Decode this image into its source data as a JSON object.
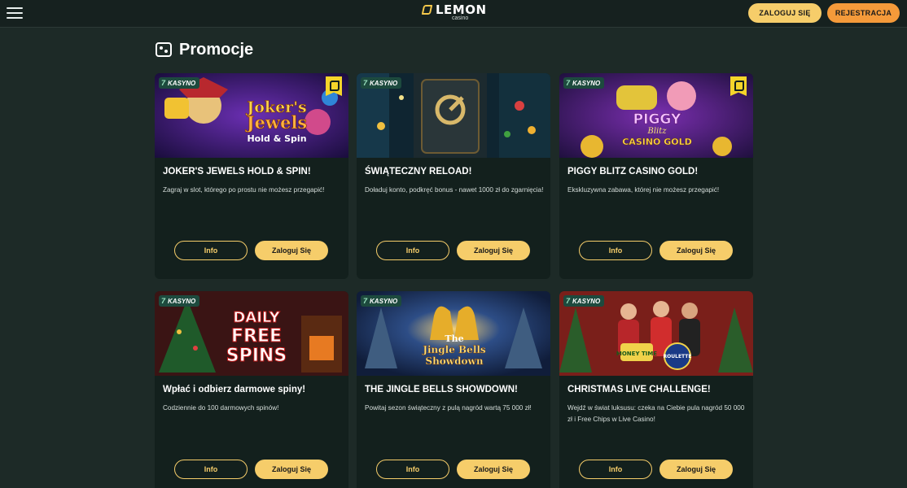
{
  "header": {
    "logo_text": "LEMON",
    "logo_sub": "casino",
    "login_label": "ZALOGUJ SIĘ",
    "register_label": "REJESTRACJA"
  },
  "page": {
    "title": "Promocje"
  },
  "badge_label": "KASYNO",
  "cards": [
    {
      "title": "JOKER'S JEWELS HOLD & SPIN!",
      "description": "Zagraj w slot, którego po prostu nie możesz przegapić!",
      "info_label": "Info",
      "login_label": "Zaloguj Się",
      "art_text": "Joker's Jewels Hold & Spin"
    },
    {
      "title": "ŚWIĄTECZNY RELOAD!",
      "description": "Doładuj konto, podkręć bonus - nawet 1000 zł do zgarnięcia!",
      "info_label": "Info",
      "login_label": "Zaloguj Się",
      "art_text": ""
    },
    {
      "title": "PIGGY BLITZ CASINO GOLD!",
      "description": "Ekskluzywna zabawa, której nie możesz przegapić!",
      "info_label": "Info",
      "login_label": "Zaloguj Się",
      "art_text": "PIGGY Blitz CASINO GOLD"
    },
    {
      "title": "Wpłać i odbierz darmowe spiny!",
      "description": "Codziennie do 100 darmowych spinów!",
      "info_label": "Info",
      "login_label": "Zaloguj Się",
      "art_text": "DAILY FREE SPINS"
    },
    {
      "title": "THE JINGLE BELLS SHOWDOWN!",
      "description": "Powitaj sezon świąteczny z pulą nagród wartą 75 000 zł!",
      "info_label": "Info",
      "login_label": "Zaloguj Się",
      "art_text": "The Jingle Bells Showdown"
    },
    {
      "title": "CHRISTMAS LIVE CHALLENGE!",
      "description": "Wejdź w świat luksusu: czeka na Ciebie pula nagród 50 000 zł i Free Chips w Live Casino!",
      "info_label": "Info",
      "login_label": "Zaloguj Się",
      "art_text": "MONEY TIME · ROULETTE 3000"
    }
  ],
  "colors": {
    "background": "#1d2a27",
    "card": "#13201d",
    "accent": "#f6cd6a",
    "register": "#f59a3a"
  }
}
